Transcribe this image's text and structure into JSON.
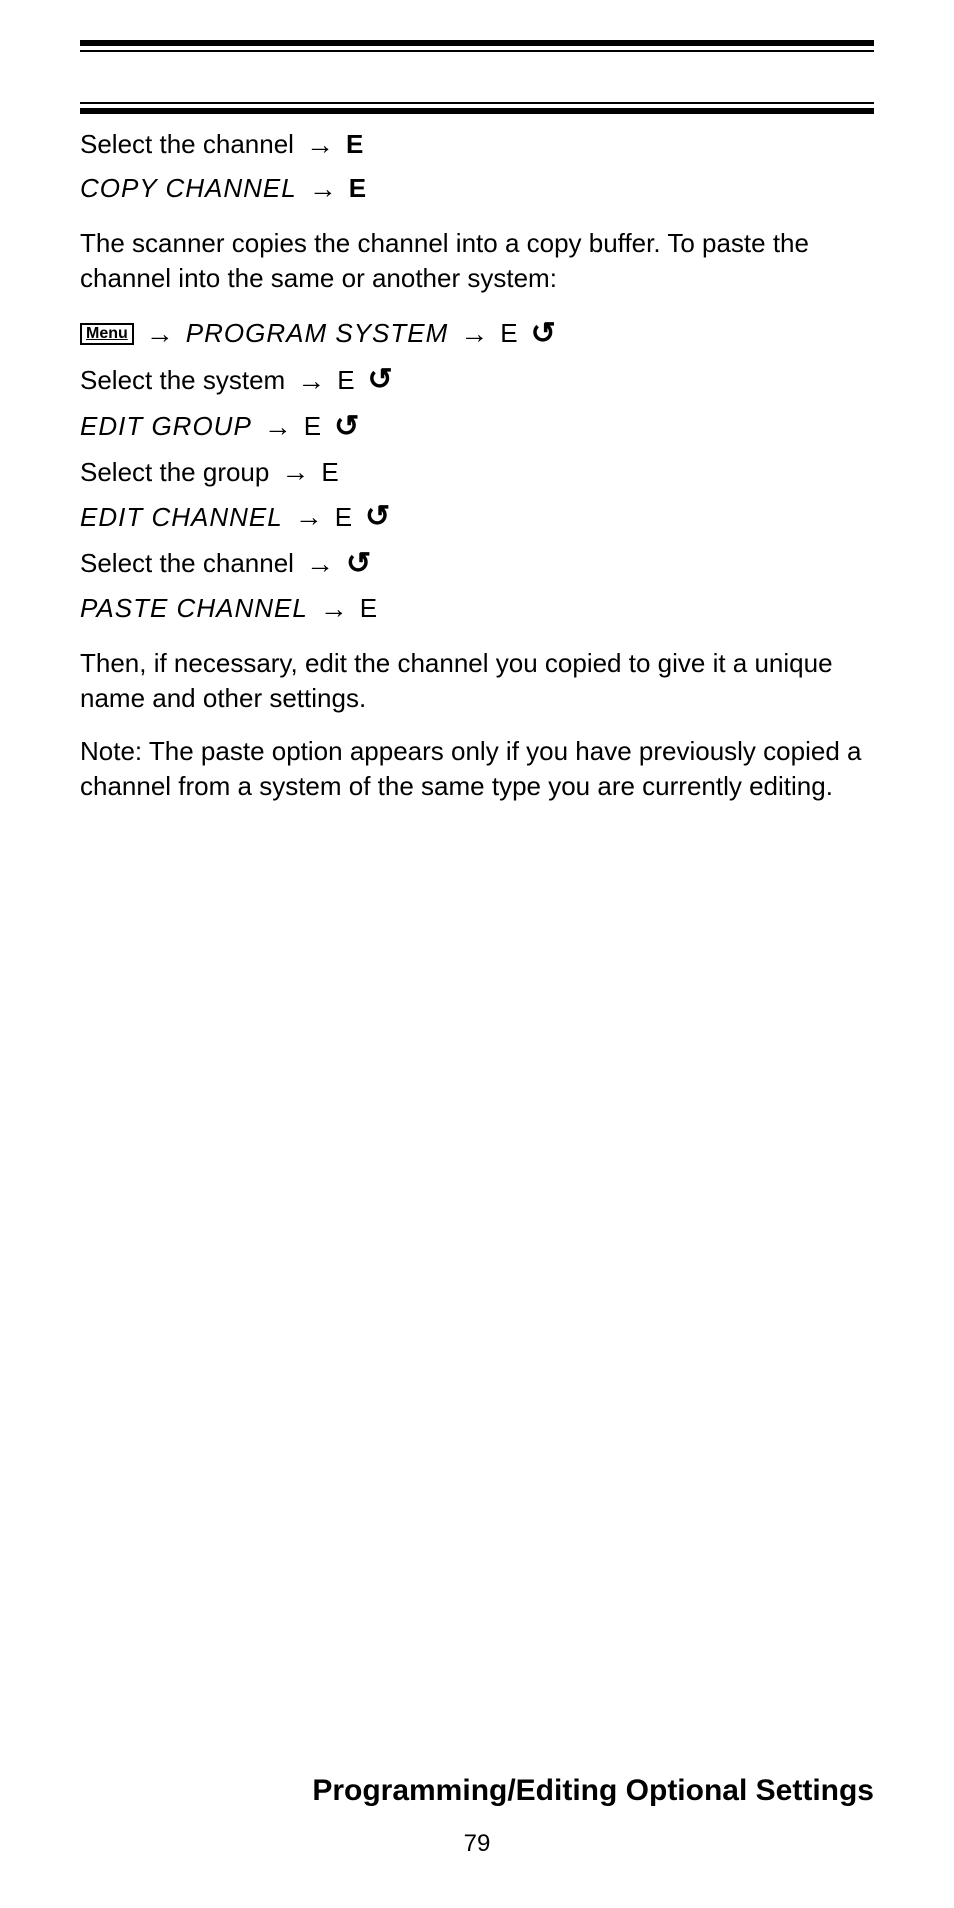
{
  "menu_label": "Menu",
  "lines": {
    "l1_text": "Select the channel",
    "l1_e": "E",
    "l2_lcd": "COPY CHANNEL",
    "l2_e": "E",
    "para1": "The scanner copies the channel into a copy buffer. To paste the channel into the same or another system:",
    "l3_lcd": "PROGRAM SYSTEM",
    "l3_e": "E",
    "l4_text": "Select the system",
    "l4_e": "E",
    "l5_lcd": "EDIT GROUP",
    "l5_e": "E",
    "l6_text": "Select the group",
    "l6_e": "E",
    "l7_lcd": "EDIT CHANNEL",
    "l7_e": "E",
    "l8_text": "Select the channel",
    "l9_lcd": "PASTE CHANNEL",
    "l9_e": "E",
    "para2": "Then, if necessary, edit the channel you copied to give it a unique name and other settings.",
    "para3": "Note: The paste option appears only if you have previously copied a channel from a system of the same type you are currently editing."
  },
  "footer_title": "Programming/Editing Optional Settings",
  "page_number": "79",
  "glyphs": {
    "arrow": "→",
    "rotate": "↺"
  }
}
